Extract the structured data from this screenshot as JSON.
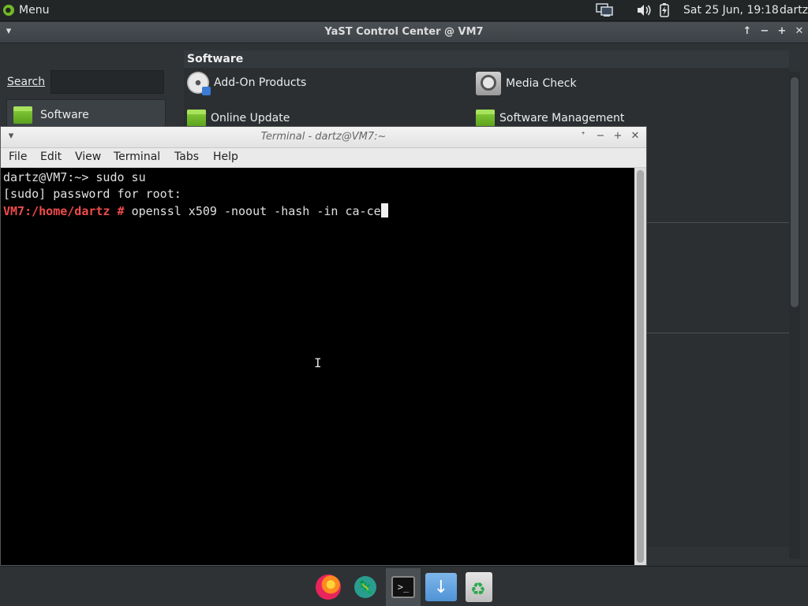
{
  "top_panel": {
    "menu_label": "Menu",
    "clock": "Sat 25 Jun, 19:18",
    "user": "dartz",
    "icons": [
      "opensuse-logo-icon",
      "network-icon",
      "volume-icon",
      "battery-icon"
    ]
  },
  "yast": {
    "title": "YaST Control Center @ VM7",
    "search_label": "Search",
    "search_value": "",
    "categories": [
      {
        "label": "Software"
      }
    ],
    "section_header": "Software",
    "modules": [
      {
        "label": "Add-On Products",
        "icon": "cd-addon-icon"
      },
      {
        "label": "Media Check",
        "icon": "media-check-icon"
      },
      {
        "label": "Online Update",
        "icon": "package-icon"
      },
      {
        "label": "Software Management",
        "icon": "package-icon"
      }
    ],
    "window_buttons": [
      "▾",
      "↑",
      "−",
      "+",
      "✕"
    ]
  },
  "terminal": {
    "title": "Terminal - dartz@VM7:~",
    "menu": [
      "File",
      "Edit",
      "View",
      "Terminal",
      "Tabs",
      "Help"
    ],
    "lines": [
      {
        "text": "dartz@VM7:~> sudo su"
      },
      {
        "text": "[sudo] password for root:"
      },
      {
        "prompt": "VM7:/home/dartz #",
        "command": "openssl x509 -noout -hash -in ca-ce"
      }
    ],
    "window_buttons": [
      "▾",
      "ᐩ",
      "−",
      "+",
      "✕"
    ]
  },
  "dock": {
    "items": [
      {
        "name": "firefox",
        "label": "🦊"
      },
      {
        "name": "gecko",
        "label": "🦎"
      },
      {
        "name": "terminal",
        "label": ">_"
      },
      {
        "name": "downloads-folder",
        "label": "↓"
      },
      {
        "name": "trash",
        "label": ""
      }
    ]
  },
  "colors": {
    "prompt_red": "#ef4b4b",
    "opensuse_green": "#73ba25",
    "terminal_bg": "#000000"
  }
}
